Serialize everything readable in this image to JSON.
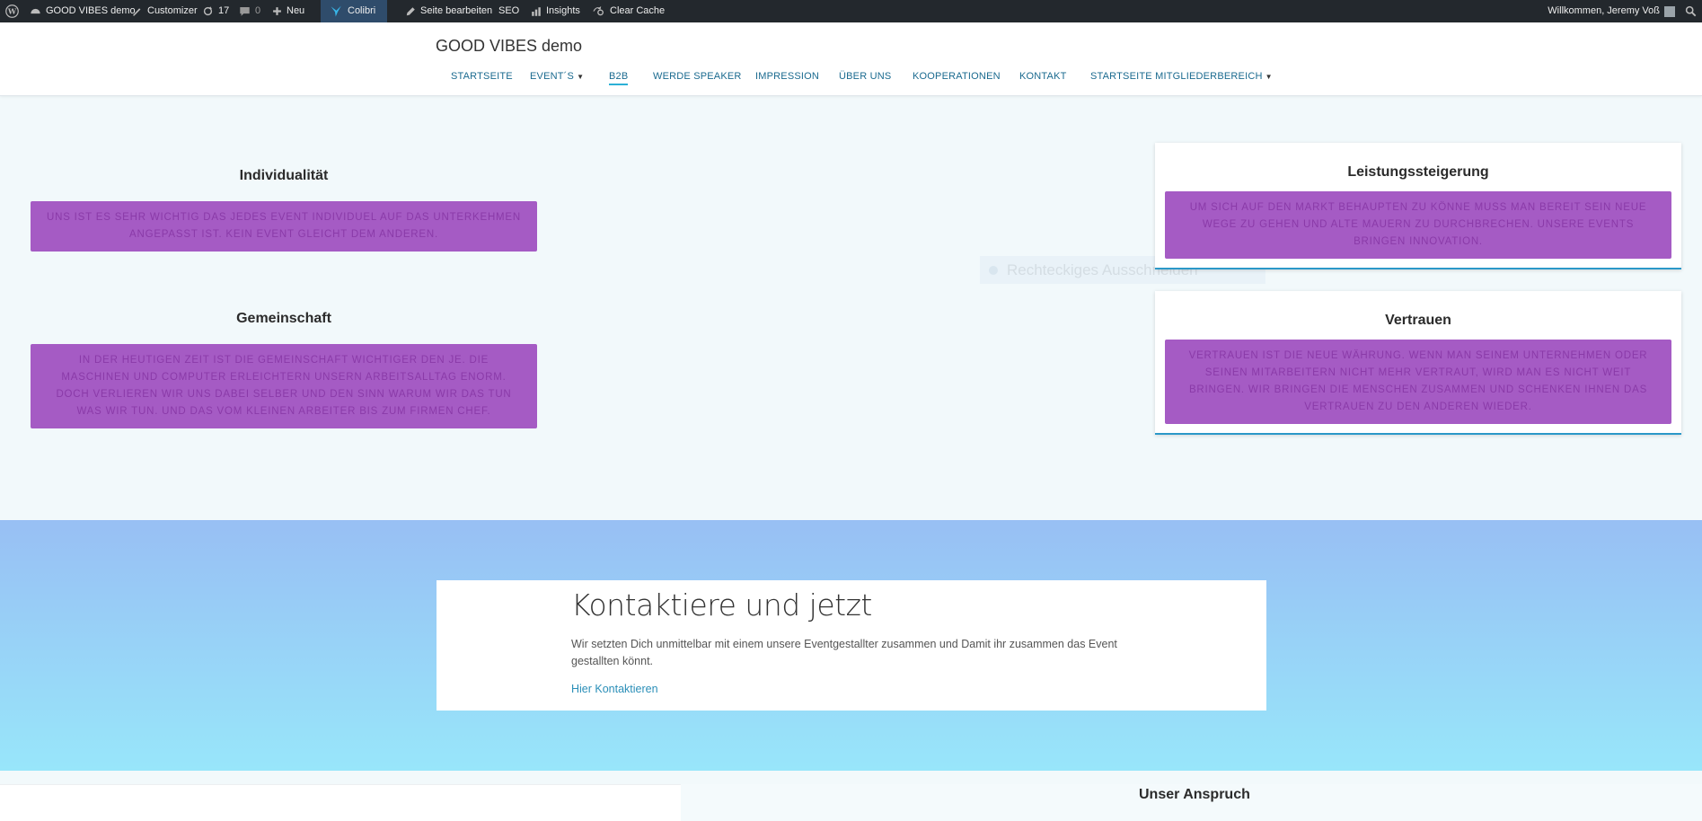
{
  "admin_bar": {
    "site_name": "GOOD VIBES demo",
    "customizer": "Customizer",
    "updates_count": "17",
    "comments_count": "0",
    "new_label": "Neu",
    "colibri": "Colibri",
    "edit_page": "Seite bearbeiten",
    "seo": "SEO",
    "insights": "Insights",
    "clear_cache": "Clear Cache",
    "welcome": "Willkommen, Jeremy Voß"
  },
  "header": {
    "site_title": "GOOD VIBES demo",
    "nav": [
      {
        "label": "STARTSEITE"
      },
      {
        "label": "EVENT´S"
      },
      {
        "label": "B2B"
      },
      {
        "label": "WERDE SPEAKER"
      },
      {
        "label": "IMPRESSION"
      },
      {
        "label": "ÜBER UNS"
      },
      {
        "label": "KOOPERATIONEN"
      },
      {
        "label": "KONTAKT"
      },
      {
        "label": "STARTSEITE MITGLIEDERBEREICH"
      }
    ]
  },
  "features": {
    "individualitaet": {
      "title": "Individualität",
      "text": "Uns ist es sehr wichtig das jedes Event individuel auf das Unterkehmen angepasst ist. Kein Event gleicht dem anderen."
    },
    "gemeinschaft": {
      "title": "Gemeinschaft",
      "text": "In der heutigen Zeit ist die Gemeinschaft wichtiger den je. Die Maschinen und Computer erleichtern unsern Arbeitsalltag enorm. Doch verlieren wir uns dabei selber und den Sinn warum wir das tun was wir tun. Und das vom kleinen Arbeiter bis zum Firmen Chef."
    },
    "leistungssteigerung": {
      "title": "Leistungssteigerung",
      "text": "Um sich auf den Markt behaupten zu könne muss man bereit sein neue Wege zu gehen und alte Mauern zu durchbrechen. Unsere Events bringen Innovation."
    },
    "vertrauen": {
      "title": "Vertrauen",
      "text": "Vertrauen ist die neue Währung. Wenn man seinem Unternehmen oder seinen Mitarbeitern nicht mehr vertraut, wird man es nicht weit bringen. Wir bringen die Menschen zusammen und schenken ihnen das Vertrauen zu den anderen wieder."
    }
  },
  "ghost_overlay": "Rechteckiges Ausschneiden",
  "contact": {
    "heading": "Kontaktiere und jetzt",
    "text": "Wir setzten Dich unmittelbar mit einem unsere Eventgestallter zusammen und Damit ihr zusammen das Event gestallten könnt.",
    "link": "Hier Kontaktieren"
  },
  "bottom": {
    "heading": "Unser Anspruch"
  }
}
